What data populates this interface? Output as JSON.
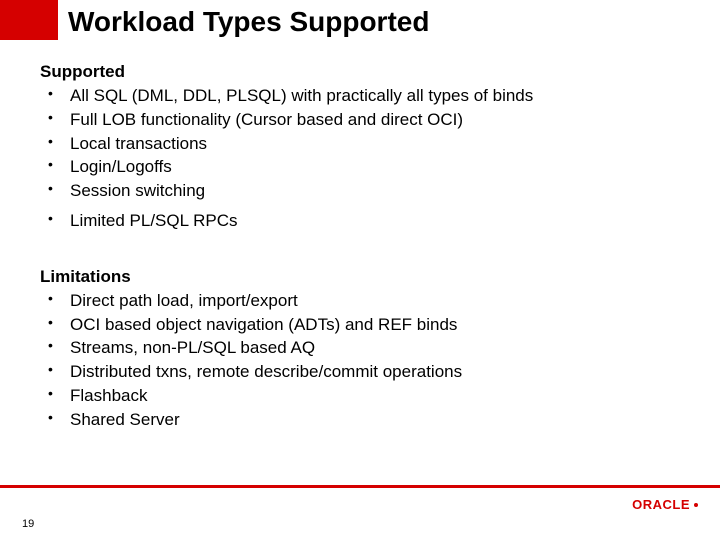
{
  "title": "Workload Types Supported",
  "sections": [
    {
      "heading": "Supported",
      "items": [
        "All SQL (DML, DDL, PLSQL) with practically all types of binds",
        "Full LOB functionality (Cursor based and direct OCI)",
        "Local transactions",
        "Login/Logoffs",
        "Session switching",
        "Limited PL/SQL RPCs"
      ],
      "last_item_gap": true
    },
    {
      "heading": "Limitations",
      "items": [
        "Direct path load, import/export",
        "OCI based object navigation (ADTs) and REF binds",
        "Streams, non-PL/SQL based AQ",
        "Distributed txns, remote describe/commit operations",
        "Flashback",
        "Shared Server"
      ],
      "last_item_gap": false
    }
  ],
  "page_number": "19",
  "logo_text": "ORACLE"
}
